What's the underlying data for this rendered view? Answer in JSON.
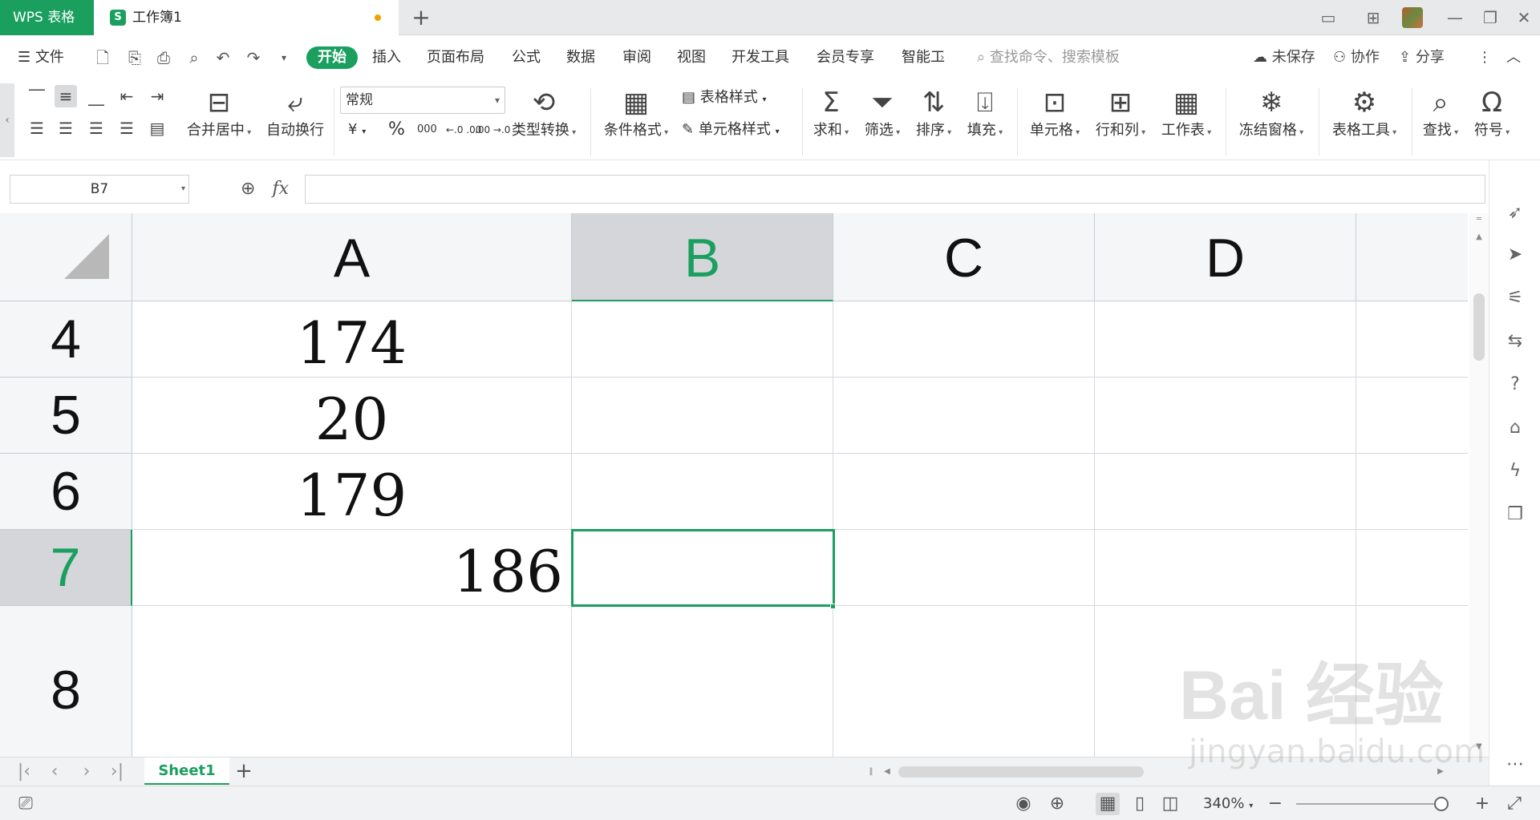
{
  "window": {
    "app_tab": "WPS 表格",
    "doc_icon": "S",
    "doc_title": "工作簿1",
    "new_tab": "+"
  },
  "menubar": {
    "file_label": "文件",
    "tabs": [
      "开始",
      "插入",
      "页面布局",
      "公式",
      "数据",
      "审阅",
      "视图",
      "开发工具",
      "会员专享",
      "智能工"
    ],
    "active_tab": "开始",
    "search_placeholder": "查找命令、搜索模板",
    "unsaved": "未保存",
    "collab": "协作",
    "share": "分享"
  },
  "ribbon": {
    "merge_center": "合并居中",
    "auto_wrap": "自动换行",
    "number_format": "常规",
    "currency": "¥",
    "percent": "%",
    "thousands": "000",
    "inc_decimal": "←.0 .00",
    "dec_decimal": ".00 →.0",
    "type_convert": "类型转换",
    "cond_format": "条件格式",
    "table_style": "表格样式",
    "cell_style": "单元格样式",
    "sum": "求和",
    "filter": "筛选",
    "sort": "排序",
    "fill": "填充",
    "cell": "单元格",
    "row_col": "行和列",
    "worksheet": "工作表",
    "freeze": "冻结窗格",
    "table_tools": "表格工具",
    "find": "查找",
    "symbol": "符号"
  },
  "formula_bar": {
    "name_box": "B7",
    "fx": "fx",
    "content": ""
  },
  "grid": {
    "columns": [
      "A",
      "B",
      "C",
      "D"
    ],
    "selected_column": "B",
    "rows": [
      {
        "label": "4",
        "A": "174"
      },
      {
        "label": "5",
        "A": "20"
      },
      {
        "label": "6",
        "A": "179"
      },
      {
        "label": "7",
        "A": "186"
      },
      {
        "label": "8",
        "A": ""
      }
    ],
    "selected_row": "7",
    "active_cell": "B7"
  },
  "sheets": {
    "tabs": [
      "Sheet1"
    ],
    "active": "Sheet1",
    "add": "+"
  },
  "status": {
    "zoom": "340%"
  },
  "watermark": {
    "line1": "Bai 经验",
    "line2": "jingyan.baidu.com"
  },
  "colors": {
    "accent": "#1a9f5f",
    "unsaved_dot": "#f0a000"
  }
}
